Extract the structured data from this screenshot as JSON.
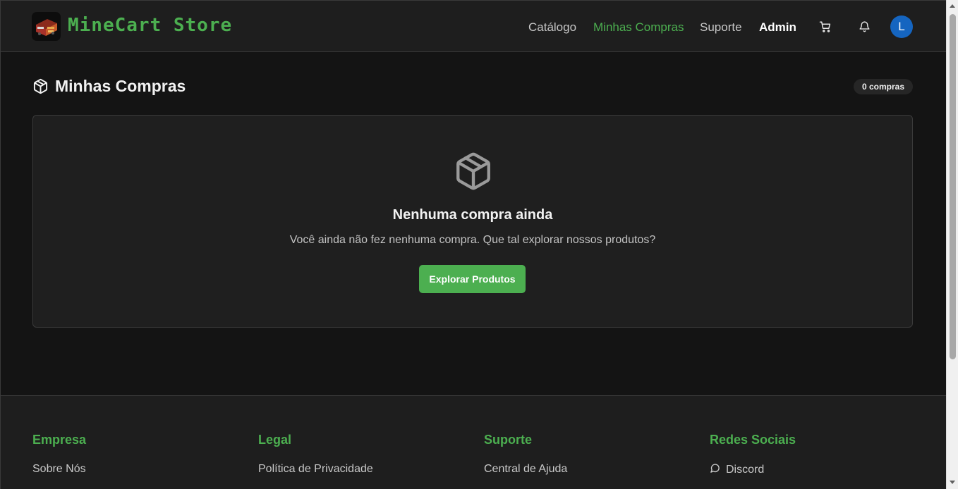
{
  "header": {
    "brand": "MineCart Store",
    "logo_icon": "minecart-chest-icon",
    "nav": [
      {
        "label": "Catálogo",
        "state": "normal"
      },
      {
        "label": "Minhas Compras",
        "state": "active"
      },
      {
        "label": "Suporte",
        "state": "normal"
      },
      {
        "label": "Admin",
        "state": "bold"
      }
    ],
    "cart_icon": "cart-icon",
    "bell_icon": "bell-icon",
    "avatar_initial": "L"
  },
  "main": {
    "title": "Minhas Compras",
    "title_icon": "package-icon",
    "count_badge": "0 compras",
    "empty_state": {
      "icon": "package-icon",
      "title": "Nenhuma compra ainda",
      "description": "Você ainda não fez nenhuma compra. Que tal explorar nossos produtos?",
      "button_label": "Explorar Produtos"
    }
  },
  "footer": {
    "columns": [
      {
        "heading": "Empresa",
        "links": [
          "Sobre Nós"
        ]
      },
      {
        "heading": "Legal",
        "links": [
          "Política de Privacidade"
        ]
      },
      {
        "heading": "Suporte",
        "links": [
          "Central de Ajuda"
        ]
      },
      {
        "heading": "Redes Sociais",
        "links": [
          "Discord"
        ]
      }
    ],
    "discord_icon": "chat-bubble-icon"
  },
  "colors": {
    "accent": "#4caf50",
    "background": "#141414",
    "surface": "#1f1f1f",
    "avatar": "#1565c0"
  }
}
